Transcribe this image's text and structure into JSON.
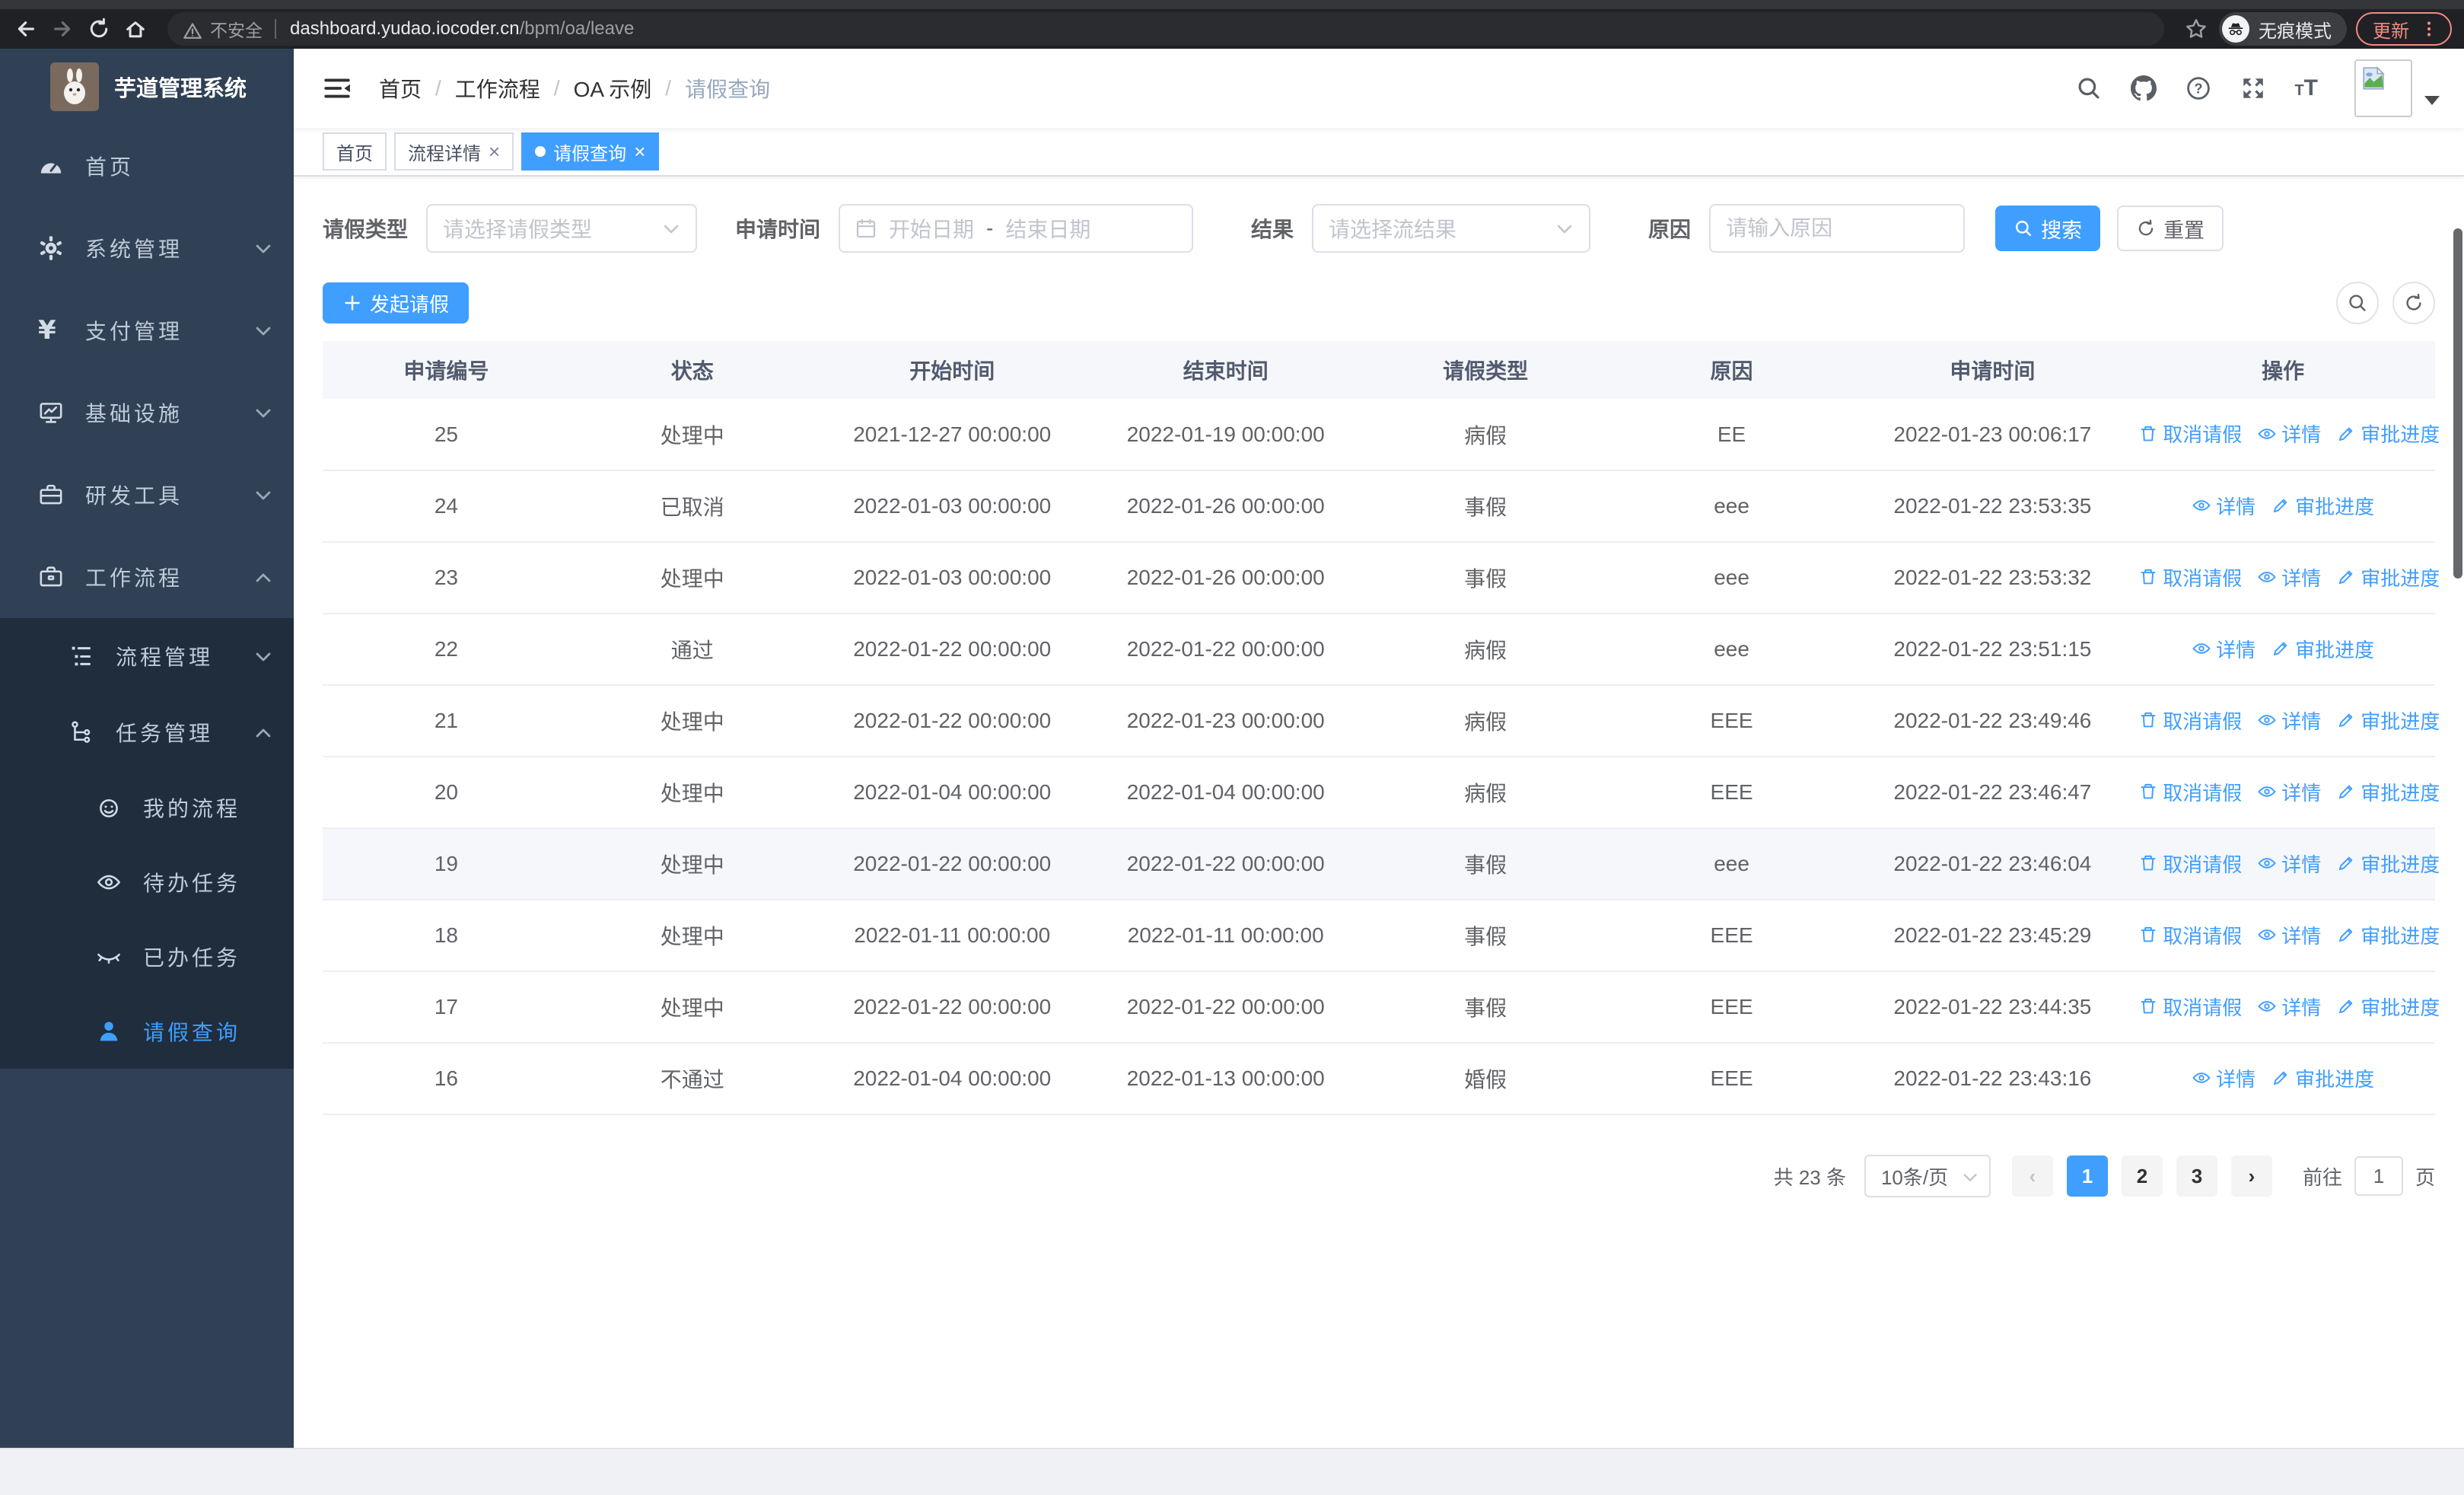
{
  "browser": {
    "security_label": "不安全",
    "url_domain": "dashboard.yudao.iocoder.cn",
    "url_path": "/bpm/oa/leave",
    "incognito_label": "无痕模式",
    "update_label": "更新"
  },
  "sidebar": {
    "title": "芋道管理系统",
    "home": "首页",
    "system": "系统管理",
    "pay": "支付管理",
    "infra": "基础设施",
    "dev": "研发工具",
    "workflow": "工作流程",
    "process_mgmt": "流程管理",
    "task_mgmt": "任务管理",
    "my_process": "我的流程",
    "todo_task": "待办任务",
    "done_task": "已办任务",
    "leave_query": "请假查询"
  },
  "header": {
    "breadcrumb": [
      "首页",
      "工作流程",
      "OA 示例",
      "请假查询"
    ]
  },
  "tabs": [
    {
      "label": "首页",
      "closable": false,
      "active": false
    },
    {
      "label": "流程详情",
      "closable": true,
      "active": false
    },
    {
      "label": "请假查询",
      "closable": true,
      "active": true
    }
  ],
  "filters": {
    "leave_type_label": "请假类型",
    "leave_type_placeholder": "请选择请假类型",
    "apply_time_label": "申请时间",
    "start_date_placeholder": "开始日期",
    "range_separator": "-",
    "end_date_placeholder": "结束日期",
    "result_label": "结果",
    "result_placeholder": "请选择流结果",
    "reason_label": "原因",
    "reason_placeholder": "请输入原因",
    "search_label": "搜索",
    "reset_label": "重置"
  },
  "toolbar": {
    "create_label": "发起请假"
  },
  "table": {
    "columns": [
      "申请编号",
      "状态",
      "开始时间",
      "结束时间",
      "请假类型",
      "原因",
      "申请时间",
      "操作"
    ],
    "actions": {
      "cancel": "取消请假",
      "detail": "详情",
      "progress": "审批进度"
    },
    "rows": [
      {
        "id": "25",
        "status": "处理中",
        "start": "2021-12-27 00:00:00",
        "end": "2022-01-19 00:00:00",
        "type": "病假",
        "reason": "EE",
        "applied": "2022-01-23 00:06:17",
        "cancellable": true,
        "highlighted": false
      },
      {
        "id": "24",
        "status": "已取消",
        "start": "2022-01-03 00:00:00",
        "end": "2022-01-26 00:00:00",
        "type": "事假",
        "reason": "eee",
        "applied": "2022-01-22 23:53:35",
        "cancellable": false,
        "highlighted": false
      },
      {
        "id": "23",
        "status": "处理中",
        "start": "2022-01-03 00:00:00",
        "end": "2022-01-26 00:00:00",
        "type": "事假",
        "reason": "eee",
        "applied": "2022-01-22 23:53:32",
        "cancellable": true,
        "highlighted": false
      },
      {
        "id": "22",
        "status": "通过",
        "start": "2022-01-22 00:00:00",
        "end": "2022-01-22 00:00:00",
        "type": "病假",
        "reason": "eee",
        "applied": "2022-01-22 23:51:15",
        "cancellable": false,
        "highlighted": false
      },
      {
        "id": "21",
        "status": "处理中",
        "start": "2022-01-22 00:00:00",
        "end": "2022-01-23 00:00:00",
        "type": "病假",
        "reason": "EEE",
        "applied": "2022-01-22 23:49:46",
        "cancellable": true,
        "highlighted": false
      },
      {
        "id": "20",
        "status": "处理中",
        "start": "2022-01-04 00:00:00",
        "end": "2022-01-04 00:00:00",
        "type": "病假",
        "reason": "EEE",
        "applied": "2022-01-22 23:46:47",
        "cancellable": true,
        "highlighted": false
      },
      {
        "id": "19",
        "status": "处理中",
        "start": "2022-01-22 00:00:00",
        "end": "2022-01-22 00:00:00",
        "type": "事假",
        "reason": "eee",
        "applied": "2022-01-22 23:46:04",
        "cancellable": true,
        "highlighted": true
      },
      {
        "id": "18",
        "status": "处理中",
        "start": "2022-01-11 00:00:00",
        "end": "2022-01-11 00:00:00",
        "type": "事假",
        "reason": "EEE",
        "applied": "2022-01-22 23:45:29",
        "cancellable": true,
        "highlighted": false
      },
      {
        "id": "17",
        "status": "处理中",
        "start": "2022-01-22 00:00:00",
        "end": "2022-01-22 00:00:00",
        "type": "事假",
        "reason": "EEE",
        "applied": "2022-01-22 23:44:35",
        "cancellable": true,
        "highlighted": false
      },
      {
        "id": "16",
        "status": "不通过",
        "start": "2022-01-04 00:00:00",
        "end": "2022-01-13 00:00:00",
        "type": "婚假",
        "reason": "EEE",
        "applied": "2022-01-22 23:43:16",
        "cancellable": false,
        "highlighted": false
      }
    ]
  },
  "pagination": {
    "total": "共 23 条",
    "page_size": "10条/页",
    "pages": [
      "1",
      "2",
      "3"
    ],
    "active_page": "1",
    "goto_label": "前往",
    "goto_value": "1",
    "page_unit": "页"
  },
  "colors": {
    "primary": "#409eff",
    "sidebar_bg": "#304156",
    "submenu_bg": "#1f2d3d",
    "update_accent": "#f28b82"
  }
}
